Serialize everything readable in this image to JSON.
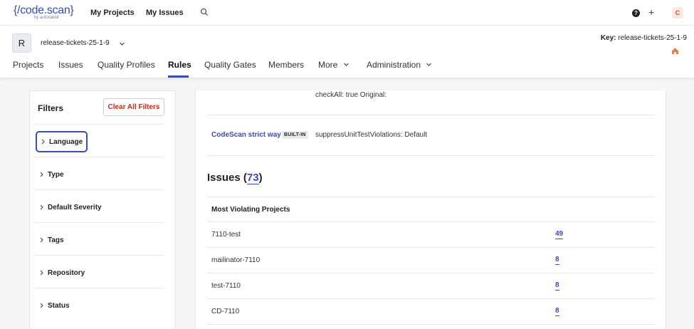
{
  "topbar": {
    "logo": "{/code.scan}",
    "logo_sub": "by autorabbit",
    "nav": [
      "My Projects",
      "My Issues"
    ],
    "icons": [
      "search-icon",
      "help-icon",
      "plus-icon"
    ],
    "avatar": "C"
  },
  "project": {
    "badge": "R",
    "name": "release-tickets-25-1-9",
    "key_label": "Key:",
    "key_value": "release-tickets-25-1-9",
    "tabs": [
      "Projects",
      "Issues",
      "Quality Profiles",
      "Rules",
      "Quality Gates",
      "Members",
      "More",
      "Administration"
    ],
    "active_tab": "Rules"
  },
  "filters": {
    "title": "Filters",
    "clear_label": "Clear All Filters",
    "facets": [
      "Language",
      "Type",
      "Default Severity",
      "Tags",
      "Repository",
      "Status"
    ]
  },
  "params": {
    "row1_text": "checkAll: true   Original:",
    "profile_name": "CodeScan strict way",
    "builtin": "BUILT-IN",
    "row2_text": "suppressUnitTestViolations: Default"
  },
  "issues": {
    "title": "Issues (",
    "count": "73",
    "close": ")",
    "most_violating_title": "Most Violating Projects",
    "projects": [
      {
        "name": "7110-test",
        "count": "49"
      },
      {
        "name": "mailinator-7110",
        "count": "8"
      },
      {
        "name": "test-7110",
        "count": "8"
      },
      {
        "name": "CD-7110",
        "count": "8"
      }
    ]
  },
  "colors": {
    "accent": "#3a4cb0",
    "danger": "#b5301e",
    "avatar_bg": "#fce8e2",
    "home_icon": "#d9825a"
  }
}
